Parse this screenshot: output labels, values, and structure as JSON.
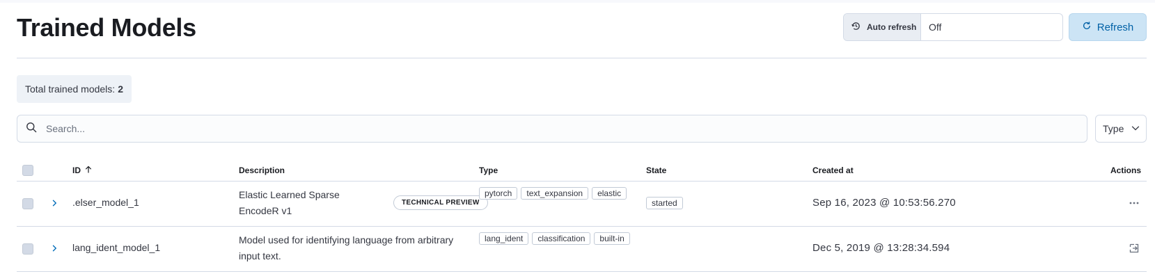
{
  "page": {
    "title": "Trained Models"
  },
  "auto_refresh": {
    "label": "Auto refresh",
    "value": "Off",
    "icon": "timer-refresh-icon"
  },
  "refresh_button": {
    "label": "Refresh",
    "icon": "refresh-icon"
  },
  "summary": {
    "label": "Total trained models:",
    "count": "2"
  },
  "search": {
    "placeholder": "Search...",
    "value": ""
  },
  "type_filter": {
    "label": "Type"
  },
  "table": {
    "headers": {
      "id": "ID",
      "description": "Description",
      "type": "Type",
      "state": "State",
      "created_at": "Created at",
      "actions": "Actions"
    },
    "sort": {
      "column": "ID",
      "direction": "ascending"
    },
    "rows": [
      {
        "id": ".elser_model_1",
        "description": "Elastic Learned Sparse EncodeR v1",
        "badge": "TECHNICAL PREVIEW",
        "types": [
          "pytorch",
          "text_expansion",
          "elastic"
        ],
        "state": "started",
        "created_at": "Sep 16, 2023 @ 10:53:56.270",
        "action_icon": "more-actions-icon"
      },
      {
        "id": "lang_ident_model_1",
        "description": "Model used for identifying language from arbitrary input text.",
        "badge": "",
        "types": [
          "lang_ident",
          "classification",
          "built-in"
        ],
        "state": "",
        "created_at": "Dec 5, 2019 @ 13:28:34.594",
        "action_icon": "export-icon"
      }
    ]
  },
  "colors": {
    "accent": "#006bb8",
    "refresh_bg": "#cce4f5",
    "border": "#d3dae6"
  }
}
